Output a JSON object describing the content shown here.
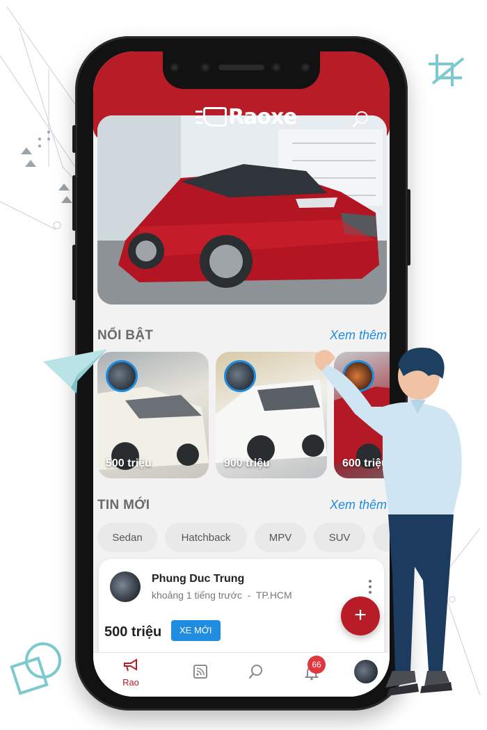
{
  "app": {
    "brand": "Raoxe"
  },
  "header": {
    "search_icon": "search-icon"
  },
  "featured_section": {
    "title": "NỔI BẬT",
    "see_more": "Xem thêm",
    "items": [
      {
        "price": "500 triệu"
      },
      {
        "price": "900 triệu"
      },
      {
        "price": "600 triệu"
      }
    ]
  },
  "new_section": {
    "title": "TIN MỚI",
    "see_more": "Xem thêm",
    "categories": [
      "Sedan",
      "Hatchback",
      "MPV",
      "SUV"
    ]
  },
  "listing": {
    "seller": "Phung Duc Trung",
    "time": "khoảng 1 tiếng trước",
    "separator": "-",
    "location": "TP.HCM",
    "price": "500 triệu",
    "badge": "XE MỚI"
  },
  "fab": {
    "label": "+"
  },
  "bottom_nav": {
    "items": [
      {
        "label": "Rao",
        "icon": "megaphone-icon"
      },
      {
        "label": "",
        "icon": "rss-icon"
      },
      {
        "label": "",
        "icon": "search-icon"
      },
      {
        "label": "",
        "icon": "bell-icon"
      },
      {
        "label": "",
        "icon": "avatar"
      }
    ],
    "notification_count": "66"
  },
  "colors": {
    "brand_red": "#b81c26",
    "accent_blue": "#1f8ce0"
  }
}
